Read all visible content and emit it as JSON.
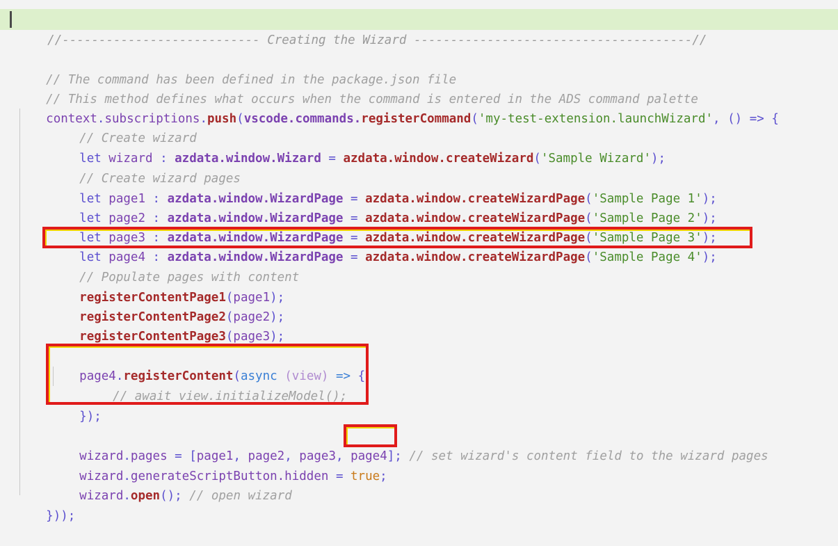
{
  "editor": {
    "background": "#f3f3f3",
    "highlight_line_background": "#ddf0cc",
    "annotation_color": "#e01b1b",
    "annotation_inner_color": "#f2d400"
  },
  "banner": {
    "text": "//--------------------------- Creating the Wizard --------------------------------------//"
  },
  "lines": {
    "l1_comment": "// The command has been defined in the package.json file",
    "l2_comment": "// This method defines what occurs when the command is entered in the ADS command palette",
    "l3": {
      "context": "context",
      "dot1": ".",
      "subscriptions": "subscriptions",
      "dot2": ".",
      "push": "push",
      "open_paren": "(",
      "vscode": "vscode",
      "dot3": ".",
      "commands": "commands",
      "dot4": ".",
      "registerCommand": "registerCommand",
      "open_paren2": "(",
      "string": "'my-test-extension.launchWizard'",
      "rest": ", () => {"
    },
    "l4_comment": "// Create wizard",
    "l5": {
      "let": "let",
      "name": " wizard ",
      "colon": ": ",
      "type": "azdata.window.Wizard",
      "eq": " = ",
      "call": "azdata.window.createWizard",
      "lp": "(",
      "arg": "'Sample Wizard'",
      "rp": ");"
    },
    "l6_comment": "// Create wizard pages",
    "l7": {
      "let": "let",
      "name": " page1 ",
      "colon": ": ",
      "type": "azdata.window.WizardPage",
      "eq": " = ",
      "call": "azdata.window.createWizardPage",
      "lp": "(",
      "arg": "'Sample Page 1'",
      "rp": ");"
    },
    "l8": {
      "let": "let",
      "name": " page2 ",
      "colon": ": ",
      "type": "azdata.window.WizardPage",
      "eq": " = ",
      "call": "azdata.window.createWizardPage",
      "lp": "(",
      "arg": "'Sample Page 2'",
      "rp": ");"
    },
    "l9": {
      "let": "let",
      "name": " page3 ",
      "colon": ": ",
      "type": "azdata.window.WizardPage",
      "eq": " = ",
      "call": "azdata.window.createWizardPage",
      "lp": "(",
      "arg": "'Sample Page 3'",
      "rp": ");"
    },
    "l10": {
      "let": "let",
      "name": " page4 ",
      "colon": ": ",
      "type": "azdata.window.WizardPage",
      "eq": " = ",
      "call": "azdata.window.createWizardPage",
      "lp": "(",
      "arg": "'Sample Page 4'",
      "rp": ");"
    },
    "l11_comment": "// Populate pages with content",
    "l12": {
      "fn": "registerContentPage1",
      "lp": "(",
      "arg": "page1",
      "rp": ");"
    },
    "l13": {
      "fn": "registerContentPage2",
      "lp": "(",
      "arg": "page2",
      "rp": ");"
    },
    "l14": {
      "fn": "registerContentPage3",
      "lp": "(",
      "arg": "page3",
      "rp": ");"
    },
    "l15": {
      "obj": "page4",
      "dot": ".",
      "fn": "registerContent",
      "lp": "(",
      "async": "async",
      "space": " ",
      "param": "(view)",
      "arrow": " => ",
      "brace": "{"
    },
    "l16_comment": "// await view.initializeModel();",
    "l17": "});",
    "l18": {
      "obj": "wizard",
      "dot": ".",
      "prop": "pages",
      "eq": " = ",
      "lb": "[",
      "p1": "page1",
      "c1": ", ",
      "p2": "page2",
      "c2": ", ",
      "p3": "page3",
      "c3": ", ",
      "p4": "page4",
      "rb": "]",
      "semi": ";",
      "comment": " // set wizard's content field to the wizard pages"
    },
    "l19": {
      "obj": "wizard",
      "dot": ".",
      "prop": "generateScriptButton.hidden",
      "eq": " = ",
      "value": "true",
      "semi": ";"
    },
    "l20": {
      "obj": "wizard",
      "dot": ".",
      "fn": "open",
      "call": "();",
      "comment": " // open wizard"
    },
    "l21": "}));"
  },
  "annotations": [
    {
      "name": "highlight-box-page4-declaration",
      "target": "let page4 : azdata.window.WizardPage = azdata.window.createWizardPage('Sample Page 4');"
    },
    {
      "name": "highlight-box-register-content",
      "target": "page4.registerContent(async (view) => { ... });"
    },
    {
      "name": "highlight-box-page4-in-array",
      "target": "page4]"
    }
  ]
}
